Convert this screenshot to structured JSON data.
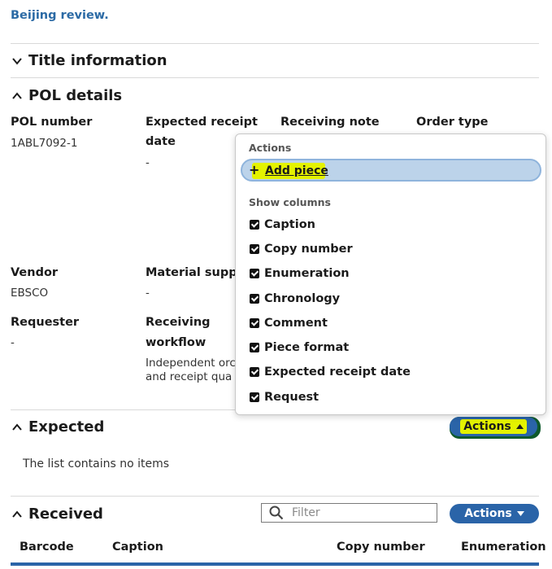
{
  "title": {
    "text": "Beijing review."
  },
  "sections": {
    "title_information": "Title information",
    "pol_details": "POL details",
    "expected": "Expected",
    "received": "Received"
  },
  "pol": {
    "pol_number_label": "POL number",
    "pol_number_value": "1ABL7092-1",
    "expected_receipt_label_1": "Expected receipt",
    "expected_receipt_label_2": "date",
    "expected_receipt_value": "-",
    "receiving_note_label": "Receiving note",
    "order_type_label": "Order type",
    "vendor_label": "Vendor",
    "vendor_value": "EBSCO",
    "material_supplier_label": "Material suppl",
    "material_supplier_value": "-",
    "requester_label": "Requester",
    "requester_value": "-",
    "receiving_workflow_label_1": "Receiving",
    "receiving_workflow_label_2": "workflow",
    "receiving_workflow_value_1": "Independent orc",
    "receiving_workflow_value_2": "and receipt qua"
  },
  "expected": {
    "actions_label": "Actions",
    "empty_text": "The list contains no items"
  },
  "received": {
    "filter_placeholder": "Filter",
    "actions_label": "Actions",
    "columns": [
      "Barcode",
      "Caption",
      "Copy number",
      "Enumeration"
    ]
  },
  "menu": {
    "actions_heading": "Actions",
    "add_piece": "Add piece",
    "show_columns_heading": "Show columns",
    "columns": [
      "Caption",
      "Copy number",
      "Enumeration",
      "Chronology",
      "Comment",
      "Piece format",
      "Expected receipt date",
      "Request"
    ]
  },
  "colors": {
    "primary": "#2a64a8",
    "link": "#2b6aa5",
    "highlight": "#e4f200"
  }
}
